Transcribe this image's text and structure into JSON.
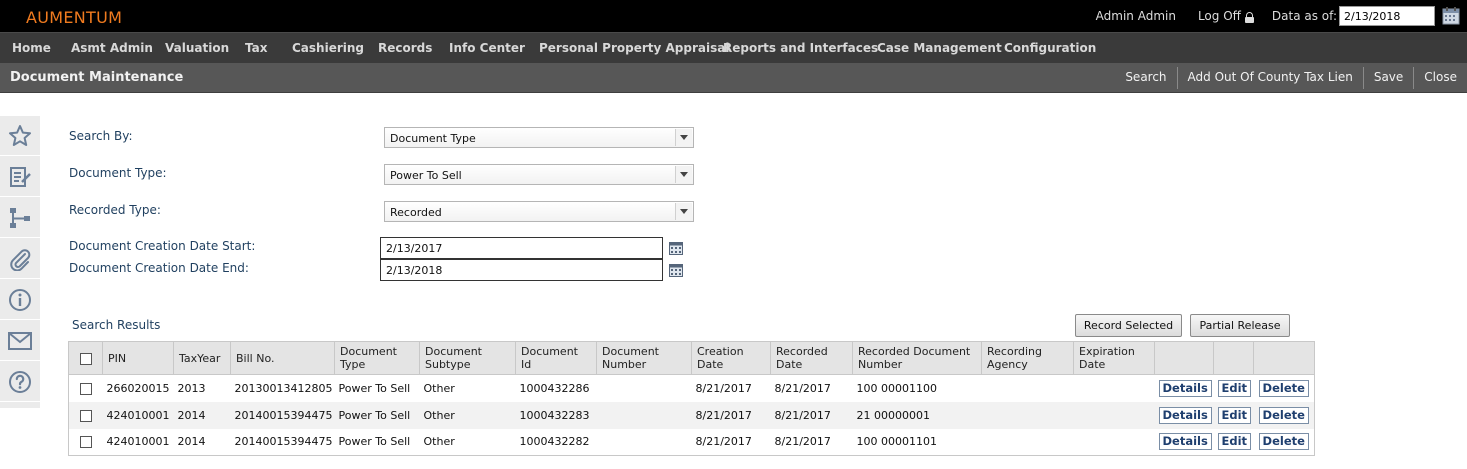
{
  "brand": "AUMENTUM",
  "top": {
    "user": "Admin Admin",
    "logoff": "Log Off",
    "data_as_of_label": "Data as of:",
    "data_as_of_value": "2/13/2018"
  },
  "menu": [
    "Home",
    "Asmt Admin",
    "Valuation",
    "Tax",
    "Cashiering",
    "Records",
    "Info Center",
    "Personal Property Appraisal",
    "Reports and Interfaces",
    "Case Management",
    "Configuration"
  ],
  "page": {
    "title": "Document Maintenance",
    "actions": [
      "Search",
      "Add Out Of County Tax Lien",
      "Save",
      "Close"
    ]
  },
  "rail_icons": [
    "star-icon",
    "edit-document-icon",
    "hierarchy-icon",
    "paperclip-icon",
    "info-icon",
    "mail-icon",
    "help-icon"
  ],
  "form": {
    "search_by_label": "Search By:",
    "search_by_value": "Document Type",
    "document_type_label": "Document Type:",
    "document_type_value": "Power To Sell",
    "recorded_type_label": "Recorded Type:",
    "recorded_type_value": "Recorded",
    "date_start_label": "Document Creation Date Start:",
    "date_start_value": "2/13/2017",
    "date_end_label": "Document Creation Date End:",
    "date_end_value": "2/13/2018"
  },
  "results": {
    "title": "Search Results",
    "record_selected": "Record Selected",
    "partial_release": "Partial Release",
    "columns": {
      "pin": "PIN",
      "tax_year": "TaxYear",
      "bill_no": "Bill No.",
      "document_type": "Document Type",
      "document_subtype": "Document Subtype",
      "document_id": "Document Id",
      "document_number": "Document Number",
      "creation_date": "Creation Date",
      "recorded_date": "Recorded Date",
      "recorded_document_number": "Recorded Document Number",
      "recording_agency": "Recording Agency",
      "expiration_date": "Expiration Date"
    },
    "action_labels": {
      "details": "Details",
      "edit": "Edit",
      "delete": "Delete"
    },
    "rows": [
      {
        "pin": "266020015",
        "tax_year": "2013",
        "bill_no": "20130013412805",
        "document_type": "Power To Sell",
        "document_subtype": "Other",
        "document_id": "1000432286",
        "document_number": "",
        "creation_date": "8/21/2017",
        "recorded_date": "8/21/2017",
        "recorded_document_number": "100 00001100",
        "recording_agency": "",
        "expiration_date": ""
      },
      {
        "pin": "424010001",
        "tax_year": "2014",
        "bill_no": "20140015394475",
        "document_type": "Power To Sell",
        "document_subtype": "Other",
        "document_id": "1000432283",
        "document_number": "",
        "creation_date": "8/21/2017",
        "recorded_date": "8/21/2017",
        "recorded_document_number": "21 00000001",
        "recording_agency": "",
        "expiration_date": ""
      },
      {
        "pin": "424010001",
        "tax_year": "2014",
        "bill_no": "20140015394475",
        "document_type": "Power To Sell",
        "document_subtype": "Other",
        "document_id": "1000432282",
        "document_number": "",
        "creation_date": "8/21/2017",
        "recorded_date": "8/21/2017",
        "recorded_document_number": "100 00001101",
        "recording_agency": "",
        "expiration_date": ""
      }
    ]
  }
}
